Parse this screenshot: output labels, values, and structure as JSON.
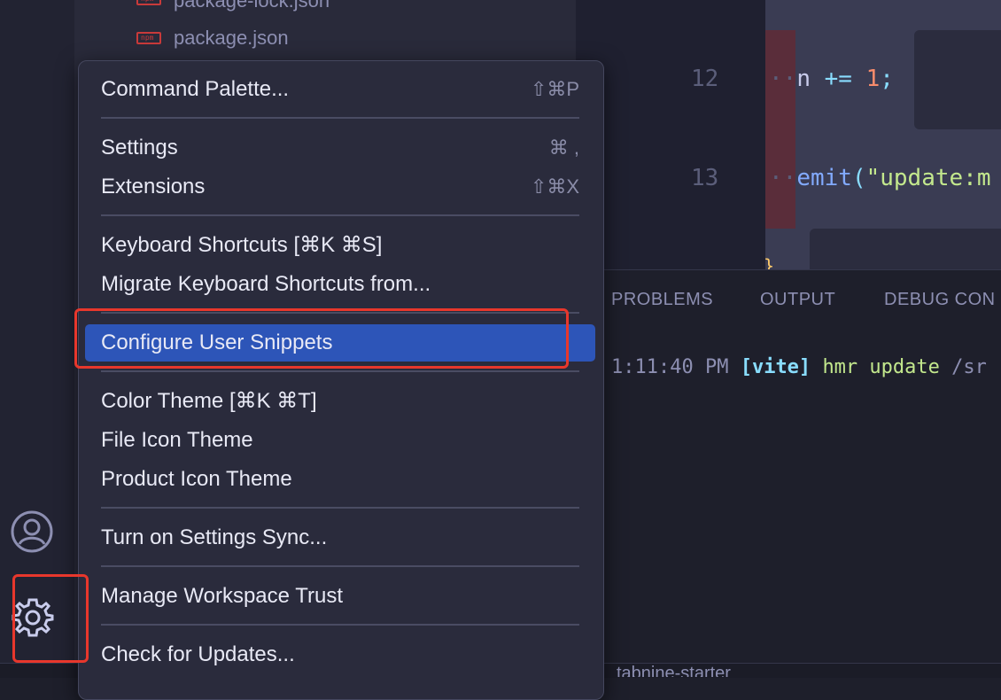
{
  "explorer": {
    "files": [
      {
        "name": "package-lock.json",
        "icon": "npm-icon"
      },
      {
        "name": "package.json",
        "icon": "npm-icon"
      }
    ]
  },
  "editor": {
    "line_numbers": [
      "12",
      "13"
    ],
    "code_line_12": {
      "dots": "··",
      "ident": "n",
      "op": "+=",
      "num": "1",
      "semi": ";"
    },
    "code_line_13": {
      "dots": "··",
      "fn": "emit",
      "paren": "(",
      "str": "\"update:m"
    },
    "brace": "}"
  },
  "panel": {
    "tabs": [
      "PROBLEMS",
      "OUTPUT",
      "DEBUG CON"
    ],
    "terminal": {
      "time": "1:11:40 PM",
      "tag": "[vite]",
      "msg": "hmr update",
      "path": "/sr"
    }
  },
  "status": {
    "branch": "tabnine-starter"
  },
  "menu": {
    "items": [
      {
        "label": "Command Palette...",
        "shortcut": "⇧⌘P"
      },
      {
        "label": "Settings",
        "shortcut": "⌘ ,"
      },
      {
        "label": "Extensions",
        "shortcut": "⇧⌘X"
      },
      {
        "label": "Keyboard Shortcuts [⌘K ⌘S]",
        "shortcut": ""
      },
      {
        "label": "Migrate Keyboard Shortcuts from...",
        "shortcut": ""
      },
      {
        "label": "Configure User Snippets",
        "shortcut": ""
      },
      {
        "label": "Color Theme [⌘K ⌘T]",
        "shortcut": ""
      },
      {
        "label": "File Icon Theme",
        "shortcut": ""
      },
      {
        "label": "Product Icon Theme",
        "shortcut": ""
      },
      {
        "label": "Turn on Settings Sync...",
        "shortcut": ""
      },
      {
        "label": "Manage Workspace Trust",
        "shortcut": ""
      },
      {
        "label": "Check for Updates...",
        "shortcut": ""
      }
    ]
  },
  "colors": {
    "highlight": "#2d55b8",
    "annotation": "#e8372c",
    "menu_bg": "#2a2b3c"
  }
}
